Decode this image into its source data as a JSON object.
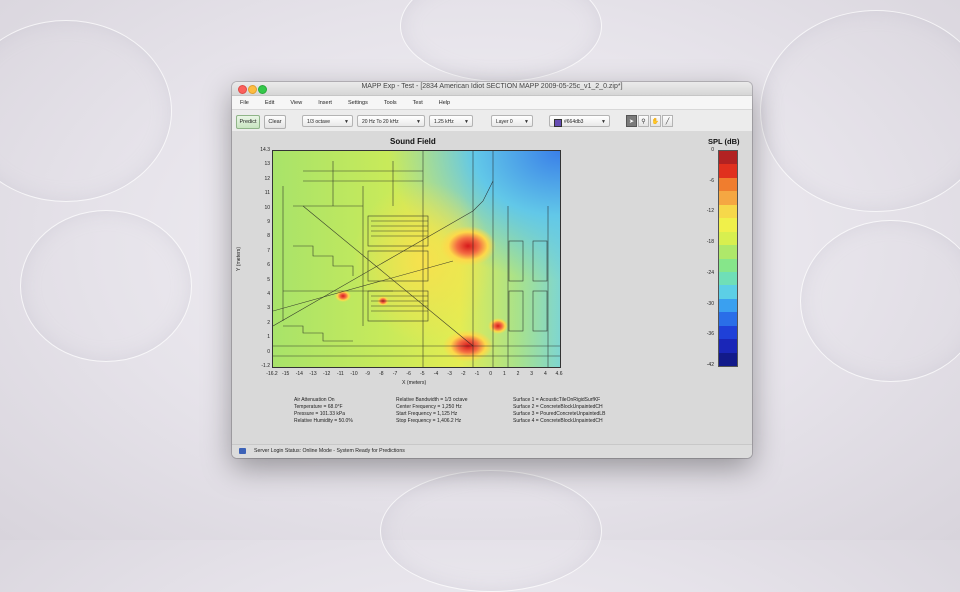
{
  "window": {
    "title": "MAPP Exp - Test - [2834 American Idiot SECTION MAPP 2009-05-25c_v1_2_0.zip*]"
  },
  "menu": [
    "File",
    "Edit",
    "View",
    "Insert",
    "Settings",
    "Tools",
    "Test",
    "Help"
  ],
  "toolbar": {
    "predict": "Predict",
    "clear": "Clear",
    "octave": "1/3 octave",
    "range": "20 Hz To 20 kHz",
    "frequency": "1.25 kHz",
    "layer": "Layer 0",
    "color_label": "#664db3",
    "color_value": "#664db3",
    "tools": [
      "select-arrow-icon",
      "zoom-icon",
      "pan-hand-icon",
      "measure-line-icon"
    ]
  },
  "plot": {
    "title": "Sound Field",
    "xlabel": "X (meters)",
    "ylabel": "Y (meters)",
    "yticks": [
      "14.3",
      "13",
      "12",
      "11",
      "10",
      "9",
      "8",
      "7",
      "6",
      "5",
      "4",
      "3",
      "2",
      "1",
      "0",
      "-1.2"
    ],
    "xticks": [
      "-16.2",
      "-15",
      "-14",
      "-13",
      "-12",
      "-11",
      "-10",
      "-9",
      "-8",
      "-7",
      "-6",
      "-5",
      "-4",
      "-3",
      "-2",
      "-1",
      "0",
      "1",
      "2",
      "3",
      "4",
      "4.6"
    ]
  },
  "colorbar": {
    "title": "SPL (dB)",
    "labels": [
      "0",
      "-6",
      "-12",
      "-18",
      "-24",
      "-30",
      "-36",
      "-42"
    ],
    "colors": [
      "#b22222",
      "#e0301e",
      "#f07d2e",
      "#f5a742",
      "#f6d84a",
      "#f0f04a",
      "#d8ef4f",
      "#aee86a",
      "#86e68a",
      "#6fdfb7",
      "#5ccfe6",
      "#3aa0f0",
      "#2a6ee8",
      "#1f40d8",
      "#1a26b8",
      "#121a8a"
    ]
  },
  "info": {
    "col1": [
      "Air Attenuation On",
      "Temperature = 68.0°F",
      "Pressure = 101.33 kPa",
      "Relative Humidity = 50.0%"
    ],
    "col2": [
      "Relative Bandwidth = 1/3 octave",
      "Center Frequency = 1,250 Hz",
      "Start Frequency = 1,125 Hz",
      "Stop Frequency = 1,406.2 Hz"
    ],
    "col3": [
      "Surface 1 = AcousticTileOnRigidSurfKF",
      "Surface 2 = ConcreteBlockUnpaintedCH",
      "Surface 3 = PouredConcreteUnpaintedLB",
      "Surface 4 = ConcreteBlockUnpaintedCH"
    ]
  },
  "status": {
    "text": "Server Login Status: Online Mode - System Ready for Predictions"
  }
}
